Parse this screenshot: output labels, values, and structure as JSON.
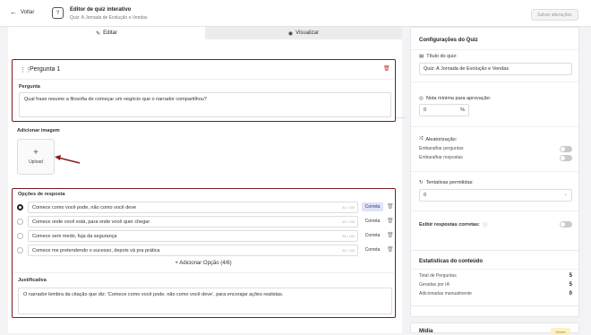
{
  "header": {
    "back_label": "Voltar",
    "title": "Editor de quiz interativo",
    "subtitle": "Quiz: A Jornada de Evolução e Vendas",
    "save_label": "Salvar alterações"
  },
  "tabs": [
    {
      "label": "Editar"
    },
    {
      "label": "Visualizar"
    }
  ],
  "question": {
    "title": "Pergunta 1",
    "prompt_label": "Pergunta",
    "prompt_value": "Qual frase resume a filosofia de começar um negócio que o narrador compartilhou?"
  },
  "image": {
    "label": "Adicionar imagem",
    "upload_label": "Upload"
  },
  "options": {
    "label": "Opções de resposta",
    "items": [
      {
        "text": "Comece como você pode, não como você deve",
        "count": "41 / 100",
        "badge": "Correta",
        "selected": true
      },
      {
        "text": "Comece onde você está, para onde você quer chegar",
        "count": "49 / 100",
        "badge": "Correta",
        "selected": false
      },
      {
        "text": "Comece sem medo, fuja da segurança",
        "count": "34 / 100",
        "badge": "Correta",
        "selected": false
      },
      {
        "text": "Comece me pretendendo o sucesso, depois vá pra prática",
        "count": "53 / 100",
        "badge": "Correta",
        "selected": false
      }
    ],
    "add_label": "Adicionar Opção (4/6)"
  },
  "justification": {
    "label": "Justificativa",
    "value": "O narrador lembra da citação que diz: 'Comece como você pode, não como você deve', para encorajar ações realistas."
  },
  "settings": {
    "title": "Configurações do Quiz",
    "quiz_title_label": "Título do quiz:",
    "quiz_title_value": "Quiz: A Jornada de Evolução e Vendas",
    "min_grade_label": "Nota mínima para aprovação:",
    "min_grade_value": "0",
    "min_grade_unit": "%",
    "random_label": "Aleatorização:",
    "shuffle_questions": "Embaralhar perguntas",
    "shuffle_answers": "Embaralhar respostas",
    "attempts_label": "Tentativas permitidas:",
    "attempts_value": "0",
    "show_correct_label": "Exibir respostas corretas:"
  },
  "stats": {
    "title": "Estatísticas do conteúdo",
    "rows": [
      {
        "label": "Total de Perguntas",
        "value": "5"
      },
      {
        "label": "Geradas por IA",
        "value": "5"
      },
      {
        "label": "Adicionadas manualmente",
        "value": "0"
      }
    ]
  },
  "media": {
    "title": "Mídia",
    "tag": "Sedes"
  }
}
